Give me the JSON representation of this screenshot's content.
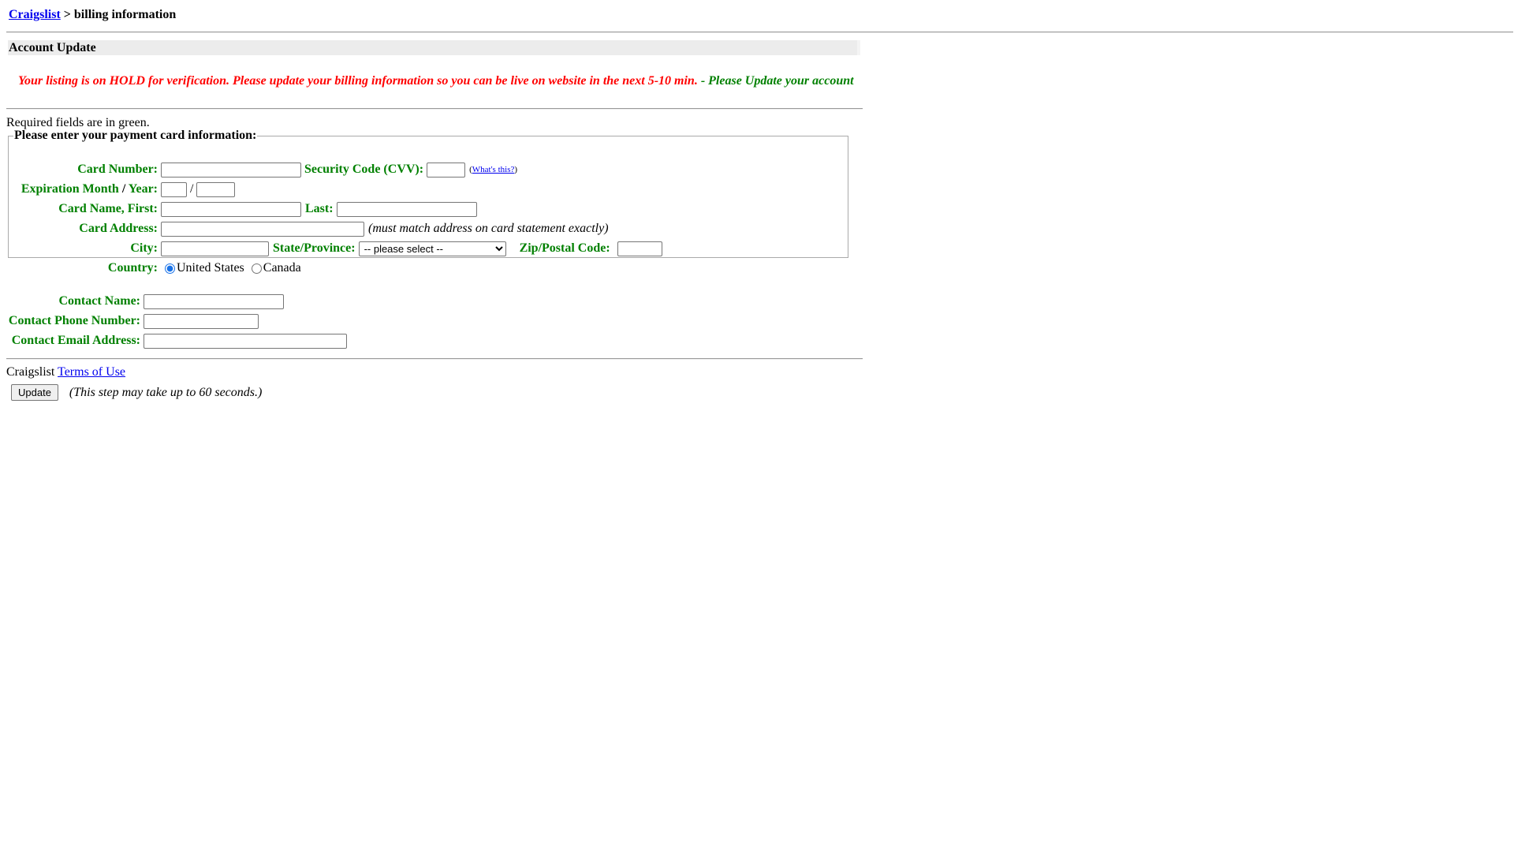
{
  "breadcrumb": {
    "site_link": "Craigslist",
    "separator": " > ",
    "current": "billing information"
  },
  "account_bar": {
    "title": "Account Update"
  },
  "notice": {
    "red_text": "Your listing is on HOLD for verification. Please update your billing information so you can be live on website in the next 5-10 min.",
    "green_text": " - Please Update your account"
  },
  "required_note": "Required fields are in green.",
  "payment": {
    "legend": "Please enter your payment card information:",
    "card_number_label": "Card Number:",
    "card_number_value": "",
    "cvv_label": "Security Code (CVV):",
    "cvv_value": "",
    "whats_this_open": "(",
    "whats_this_link": "What's this?",
    "whats_this_close": ")",
    "expiration_label_a": "Expiration Month",
    "expiration_label_sep": " / ",
    "expiration_label_b": "Year:",
    "exp_month_value": "",
    "exp_slash": "/",
    "exp_year_value": "",
    "card_name_first_label": "Card Name, First:",
    "first_value": "",
    "last_label": "Last:",
    "last_value": "",
    "card_address_label": "Card Address:",
    "address_value": "",
    "address_note": "(must match address on card statement exactly)",
    "city_label": "City:",
    "city_value": "",
    "state_label": "State/Province:",
    "state_selected": "-- please select --",
    "zip_label": "Zip/Postal Code:",
    "zip_value": "",
    "country_label": "Country:",
    "country_options": [
      "United States",
      "Canada"
    ],
    "country_selected": "United States"
  },
  "contact": {
    "name_label": "Contact Name:",
    "name_value": "",
    "phone_label": "Contact Phone Number:",
    "phone_value": "",
    "email_label": "Contact Email Address:",
    "email_value": ""
  },
  "footer": {
    "terms_prefix": "Craigslist ",
    "terms_link": "Terms of Use",
    "update_button": "Update",
    "update_note": "(This step may take up to 60 seconds.)"
  },
  "colors": {
    "required_label": "#008000",
    "notice_red": "#ff0000",
    "link": "#0000ee",
    "account_bar_bg": "#ececec"
  }
}
